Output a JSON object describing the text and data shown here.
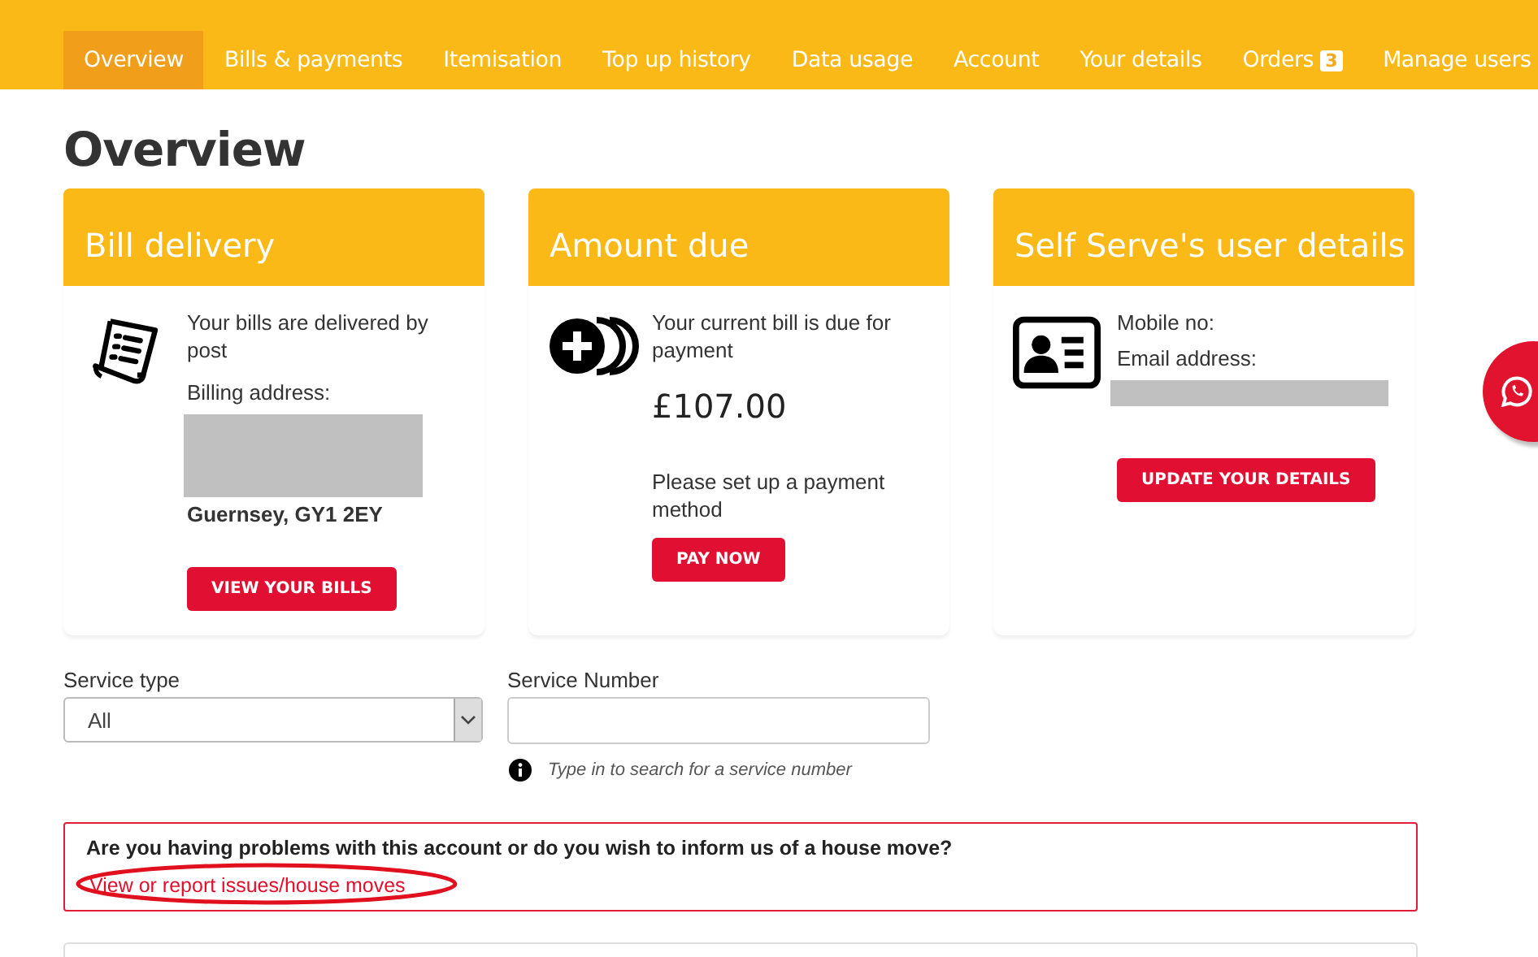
{
  "nav": [
    {
      "label": "Overview",
      "selected": true
    },
    {
      "label": "Bills & payments",
      "selected": false
    },
    {
      "label": "Itemisation",
      "selected": false
    },
    {
      "label": "Top up history",
      "selected": false
    },
    {
      "label": "Data usage",
      "selected": false
    },
    {
      "label": "Account",
      "selected": false
    },
    {
      "label": "Your details",
      "selected": false
    },
    {
      "label": "Orders",
      "selected": false,
      "badge": "3"
    },
    {
      "label": "Manage users",
      "selected": false
    }
  ],
  "page_title": "Overview",
  "cards": [
    {
      "kind": "bill",
      "title": "Bill delivery",
      "text": "Your bills are delivered by post",
      "label": "Billing address:",
      "address": "Guernsey, GY1 2EY",
      "button": "VIEW YOUR BILLS"
    },
    {
      "kind": "amount",
      "title": "Amount due",
      "text": "Your current bill is due for payment",
      "amount": "£107.00",
      "note": "Please set up a payment method",
      "button": "PAY NOW"
    },
    {
      "kind": "user",
      "title": "Self Serve's user details",
      "fields": [
        "Mobile no:",
        "Email address:"
      ],
      "button": "UPDATE YOUR DETAILS"
    }
  ],
  "filters": {
    "service_type": {
      "label": "Service type",
      "value": "All"
    },
    "service_number": {
      "label": "Service Number",
      "hint": "Type in to search for a service number"
    }
  },
  "alert": {
    "text": "Are you having problems with this account or do you wish to inform us of a house move?",
    "link": "View or report issues/house moves"
  }
}
